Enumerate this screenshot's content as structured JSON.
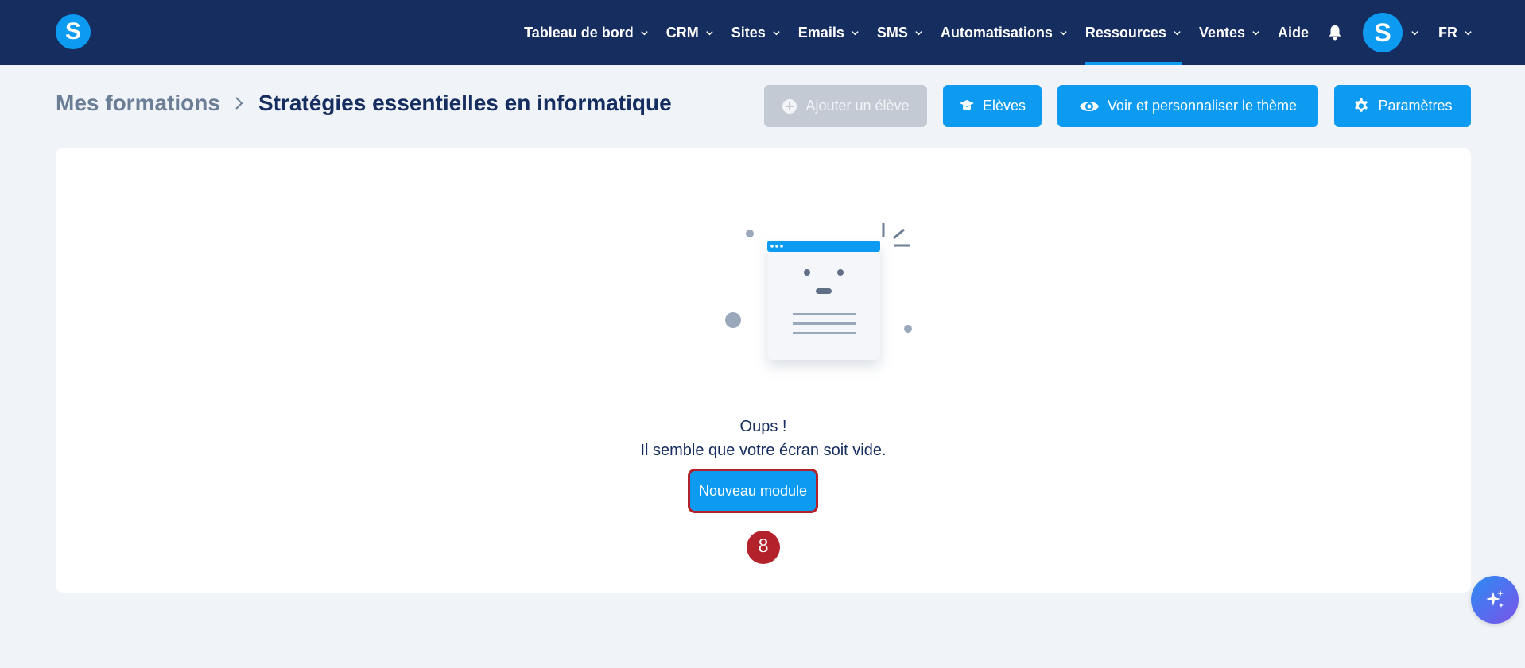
{
  "app": {
    "logo_letter": "S"
  },
  "nav": {
    "items": [
      {
        "label": "Tableau de bord",
        "dropdown": true,
        "active": false
      },
      {
        "label": "CRM",
        "dropdown": true,
        "active": false
      },
      {
        "label": "Sites",
        "dropdown": true,
        "active": false
      },
      {
        "label": "Emails",
        "dropdown": true,
        "active": false
      },
      {
        "label": "SMS",
        "dropdown": true,
        "active": false
      },
      {
        "label": "Automatisations",
        "dropdown": true,
        "active": false
      },
      {
        "label": "Ressources",
        "dropdown": true,
        "active": true
      },
      {
        "label": "Ventes",
        "dropdown": true,
        "active": false
      },
      {
        "label": "Aide",
        "dropdown": false,
        "active": false
      }
    ],
    "bell_icon": "bell-icon",
    "avatar_letter": "S",
    "language": "FR"
  },
  "breadcrumb": {
    "parent": "Mes formations",
    "current": "Stratégies essentielles en informatique"
  },
  "toolbar": {
    "add_student_label": "Ajouter un élève",
    "students_label": "Elèves",
    "theme_label": "Voir et personnaliser le thème",
    "settings_label": "Paramètres"
  },
  "empty_state": {
    "title": "Oups !",
    "subtitle": "Il semble que votre écran soit vide.",
    "new_module_label": "Nouveau module"
  },
  "annotation": {
    "step_number": "8"
  },
  "colors": {
    "nav_bg": "#162d60",
    "accent": "#0d9bf2",
    "disabled": "#c3cad3",
    "highlight": "#b3222b",
    "page_bg": "#f0f4f9"
  }
}
